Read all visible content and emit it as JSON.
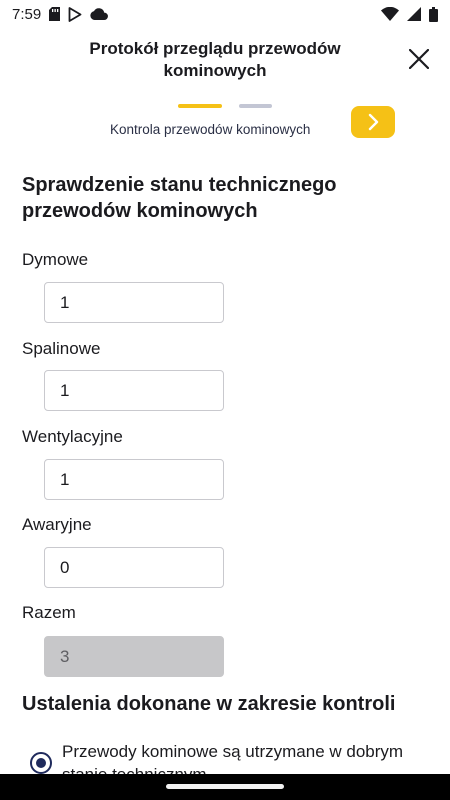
{
  "status_bar": {
    "time": "7:59",
    "left_icons": [
      "sd-card-icon",
      "play-protect-icon",
      "cloud-icon"
    ],
    "right_icons": [
      "wifi-icon",
      "signal-icon",
      "battery-icon"
    ]
  },
  "header": {
    "title": "Protokół przeglądu przewodów kominowych",
    "close_icon": "close-icon"
  },
  "stepper": {
    "current_step_label": "Kontrola przewodów kominowych",
    "next_icon": "chevron-right-icon",
    "accent_color": "#f5c116",
    "inactive_color": "#c3c6d4"
  },
  "section1": {
    "title": "Sprawdzenie stanu technicznego przewodów kominowych",
    "fields": [
      {
        "label": "Dymowe",
        "value": "1"
      },
      {
        "label": "Spalinowe",
        "value": "1"
      },
      {
        "label": "Wentylacyjne",
        "value": "1"
      },
      {
        "label": "Awaryjne",
        "value": "0"
      },
      {
        "label": "Razem",
        "value": "3",
        "disabled": true
      }
    ]
  },
  "section2": {
    "title": "Ustalenia dokonane w zakresie kontroli",
    "options": [
      {
        "label": "Przewody kominowe są utrzymane w dobrym stanie technicznym",
        "selected": true
      }
    ]
  }
}
